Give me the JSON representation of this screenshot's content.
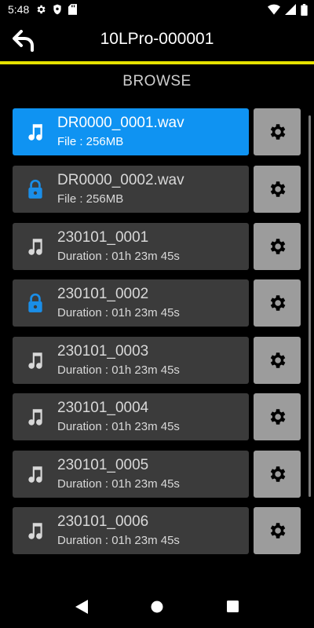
{
  "status_bar": {
    "time": "5:48",
    "icons": [
      "gear-icon",
      "shield-icon",
      "sd-card-icon",
      "wifi-icon",
      "signal-icon",
      "battery-icon"
    ]
  },
  "header": {
    "title": "10LPro-000001",
    "back_icon": "back-arrow-icon",
    "accent_color": "#e5e100"
  },
  "section": {
    "title": "BROWSE"
  },
  "files": [
    {
      "name": "DR0000_0001.wav",
      "meta": "File : 256MB",
      "icon": "music-note-icon",
      "selected": true
    },
    {
      "name": "DR0000_0002.wav",
      "meta": "File : 256MB",
      "icon": "lock-icon",
      "selected": false
    },
    {
      "name": "230101_0001",
      "meta": "Duration : 01h 23m 45s",
      "icon": "music-note-icon",
      "selected": false
    },
    {
      "name": "230101_0002",
      "meta": "Duration : 01h 23m 45s",
      "icon": "lock-icon",
      "selected": false
    },
    {
      "name": "230101_0003",
      "meta": "Duration : 01h 23m 45s",
      "icon": "music-note-icon",
      "selected": false
    },
    {
      "name": "230101_0004",
      "meta": "Duration : 01h 23m 45s",
      "icon": "music-note-icon",
      "selected": false
    },
    {
      "name": "230101_0005",
      "meta": "Duration : 01h 23m 45s",
      "icon": "music-note-icon",
      "selected": false
    },
    {
      "name": "230101_0006",
      "meta": "Duration : 01h 23m 45s",
      "icon": "music-note-icon",
      "selected": false
    }
  ],
  "colors": {
    "selected": "#0f93f2",
    "card": "#3b3b3b",
    "settings_button": "#9c9c9c",
    "lock": "#1a8ee8"
  },
  "nav_bar": {
    "icons": [
      "back-triangle-icon",
      "home-circle-icon",
      "recents-square-icon"
    ]
  }
}
